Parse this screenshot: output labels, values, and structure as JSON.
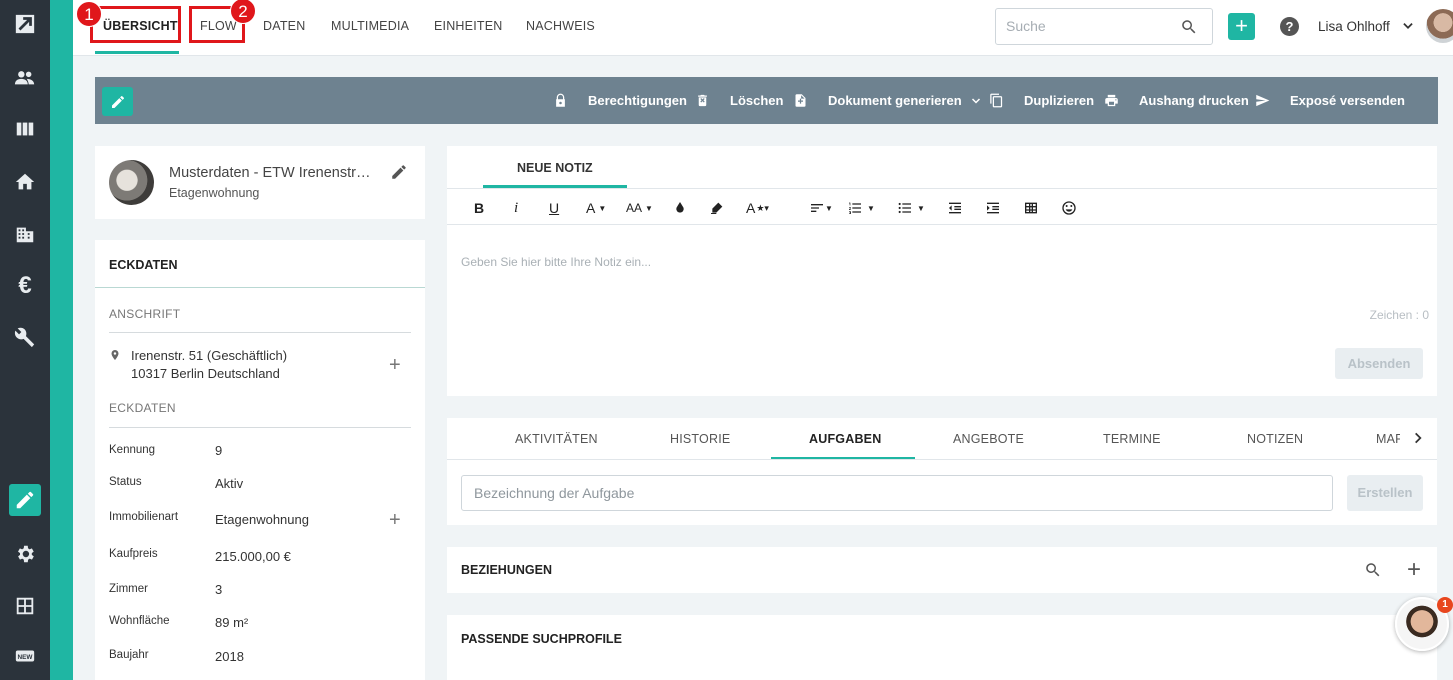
{
  "nav": {
    "tabs": [
      {
        "label": "ÜBERSICHT",
        "active": true
      },
      {
        "label": "FLOW"
      },
      {
        "label": "DATEN"
      },
      {
        "label": "MULTIMEDIA"
      },
      {
        "label": "EINHEITEN"
      },
      {
        "label": "NACHWEIS"
      }
    ],
    "markers": [
      "1",
      "2"
    ],
    "search_placeholder": "Suche",
    "add_label": "+",
    "help_label": "?",
    "user_name": "Lisa Ohlhoff"
  },
  "actions": {
    "berechtigungen": "Berechtigungen",
    "loeschen": "Löschen",
    "dokument": "Dokument generieren",
    "duplizieren": "Duplizieren",
    "aushang": "Aushang drucken",
    "expose": "Exposé versenden"
  },
  "property": {
    "title": "Musterdaten - ETW Irenenstraße",
    "type": "Etagenwohnung"
  },
  "eckdaten": {
    "heading": "ECKDATEN",
    "anschrift_heading": "ANSCHRIFT",
    "address_line1": "Irenenstr. 51  (Geschäftlich)",
    "address_line2": "10317  Berlin  Deutschland",
    "eckdaten_sub": "ECKDATEN",
    "rows": [
      {
        "label": "Kennung",
        "value": "9"
      },
      {
        "label": "Status",
        "value": "Aktiv"
      },
      {
        "label": "Immobilienart",
        "value": "Etagenwohnung"
      },
      {
        "label": "Kaufpreis",
        "value": "215.000,00 €"
      },
      {
        "label": "Zimmer",
        "value": "3"
      },
      {
        "label": "Wohnfläche",
        "value": "89 m²"
      },
      {
        "label": "Baujahr",
        "value": "2018"
      }
    ]
  },
  "notiz": {
    "tab": "NEUE NOTIZ",
    "placeholder": "Geben Sie hier bitte Ihre Notiz ein...",
    "chars": "Zeichen : 0",
    "send": "Absenden",
    "toolbar": {
      "bold": "B",
      "italic": "i",
      "underline": "U",
      "font_color": "A",
      "font_size": "AA",
      "font_style": "A"
    }
  },
  "tabs2": {
    "items": [
      "AKTIVITÄTEN",
      "HISTORIE",
      "AUFGABEN",
      "ANGEBOTE",
      "TERMINE",
      "NOTIZEN",
      "MAR"
    ],
    "active": "AUFGABEN",
    "task_placeholder": "Bezeichnung der Aufgabe",
    "create": "Erstellen"
  },
  "beziehungen": {
    "heading": "BEZIEHUNGEN"
  },
  "suchprofile": {
    "heading": "PASSENDE SUCHPROFILE"
  },
  "chat": {
    "badge": "1"
  },
  "colors": {
    "accent": "#1fb6a3",
    "sidebar": "#2b333b",
    "actionbar": "#6e8290",
    "highlight": "#e0171b"
  }
}
